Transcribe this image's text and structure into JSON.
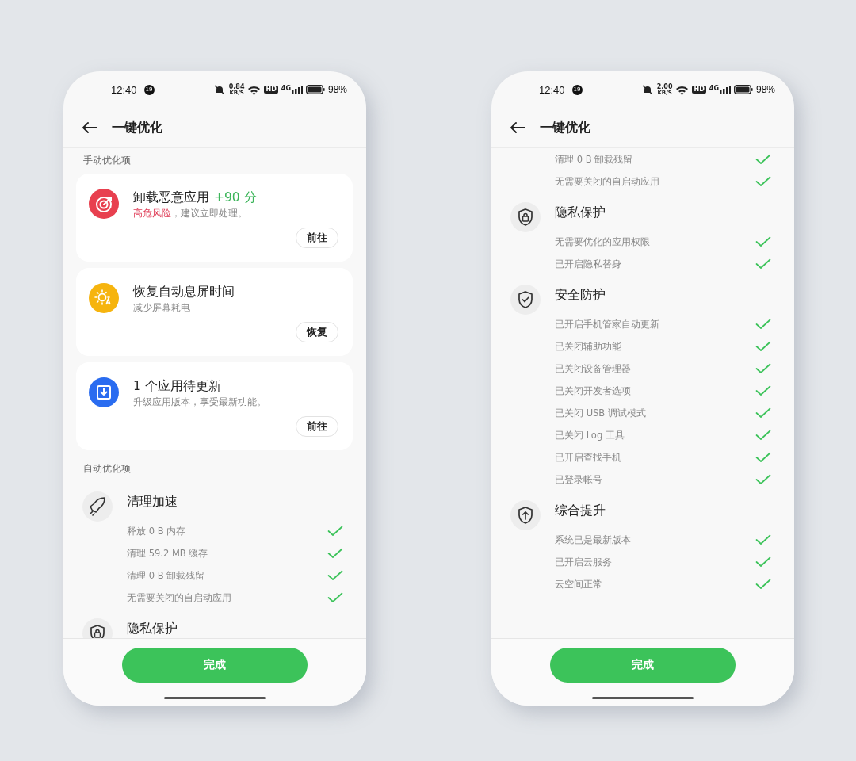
{
  "screens": [
    {
      "status_bar": {
        "time": "12:40",
        "notification_count": "19",
        "net_speed": "0.84",
        "net_unit": "KB/S",
        "hd": "HD",
        "network": "4G",
        "battery": "98%"
      },
      "title": "一键优化",
      "sections": [
        {
          "label": "手动优化项",
          "cards": [
            {
              "kind": "malware",
              "title": "卸载恶意应用",
              "score": "+90 分",
              "warning": "高危风险",
              "subtitle": "，建议立即处理。",
              "action": "前往",
              "color": "#e8404f"
            },
            {
              "kind": "screen",
              "title": "恢复自动息屏时间",
              "subtitle": "减少屏幕耗电",
              "action": "恢复",
              "color": "#f6b40e"
            },
            {
              "kind": "update",
              "title": "1 个应用待更新",
              "subtitle": "升级应用版本，享受最新功能。",
              "action": "前往",
              "color": "#2a6cf0"
            }
          ]
        },
        {
          "label": "自动优化项",
          "groups": [
            {
              "kind": "cleanup",
              "title": "清理加速",
              "rows": [
                {
                  "text": "释放 0 B 内存",
                  "done": true
                },
                {
                  "text": "清理 59.2 MB 缓存",
                  "done": true
                },
                {
                  "text": "清理 0 B 卸载残留",
                  "done": true
                },
                {
                  "text": "无需要关闭的自启动应用",
                  "done": true
                }
              ]
            },
            {
              "kind": "privacy",
              "title": "隐私保护"
            }
          ]
        }
      ],
      "done_button": "完成"
    },
    {
      "status_bar": {
        "time": "12:40",
        "notification_count": "19",
        "net_speed": "2.00",
        "net_unit": "KB/S",
        "hd": "HD",
        "network": "4G",
        "battery": "98%"
      },
      "title": "一键优化",
      "sections": [
        {
          "groups": [
            {
              "kind": "cleanup",
              "rows": [
                {
                  "text": "清理 0 B 卸载残留",
                  "done": true
                },
                {
                  "text": "无需要关闭的自启动应用",
                  "done": true
                }
              ]
            },
            {
              "kind": "privacy",
              "title": "隐私保护",
              "rows": [
                {
                  "text": "无需要优化的应用权限",
                  "done": true
                },
                {
                  "text": "已开启隐私替身",
                  "done": true
                }
              ]
            },
            {
              "kind": "security",
              "title": "安全防护",
              "rows": [
                {
                  "text": "已开启手机管家自动更新",
                  "done": true
                },
                {
                  "text": "已关闭辅助功能",
                  "done": true
                },
                {
                  "text": "已关闭设备管理器",
                  "done": true
                },
                {
                  "text": "已关闭开发者选项",
                  "done": true
                },
                {
                  "text": "已关闭 USB 调试模式",
                  "done": true
                },
                {
                  "text": "已关闭 Log 工具",
                  "done": true
                },
                {
                  "text": "已开启查找手机",
                  "done": true
                },
                {
                  "text": "已登录帐号",
                  "done": true
                }
              ]
            },
            {
              "kind": "boost",
              "title": "综合提升",
              "rows": [
                {
                  "text": "系统已是最新版本",
                  "done": true
                },
                {
                  "text": "已开启云服务",
                  "done": true
                },
                {
                  "text": "云空间正常",
                  "done": true
                }
              ]
            }
          ]
        }
      ],
      "done_button": "完成"
    }
  ]
}
